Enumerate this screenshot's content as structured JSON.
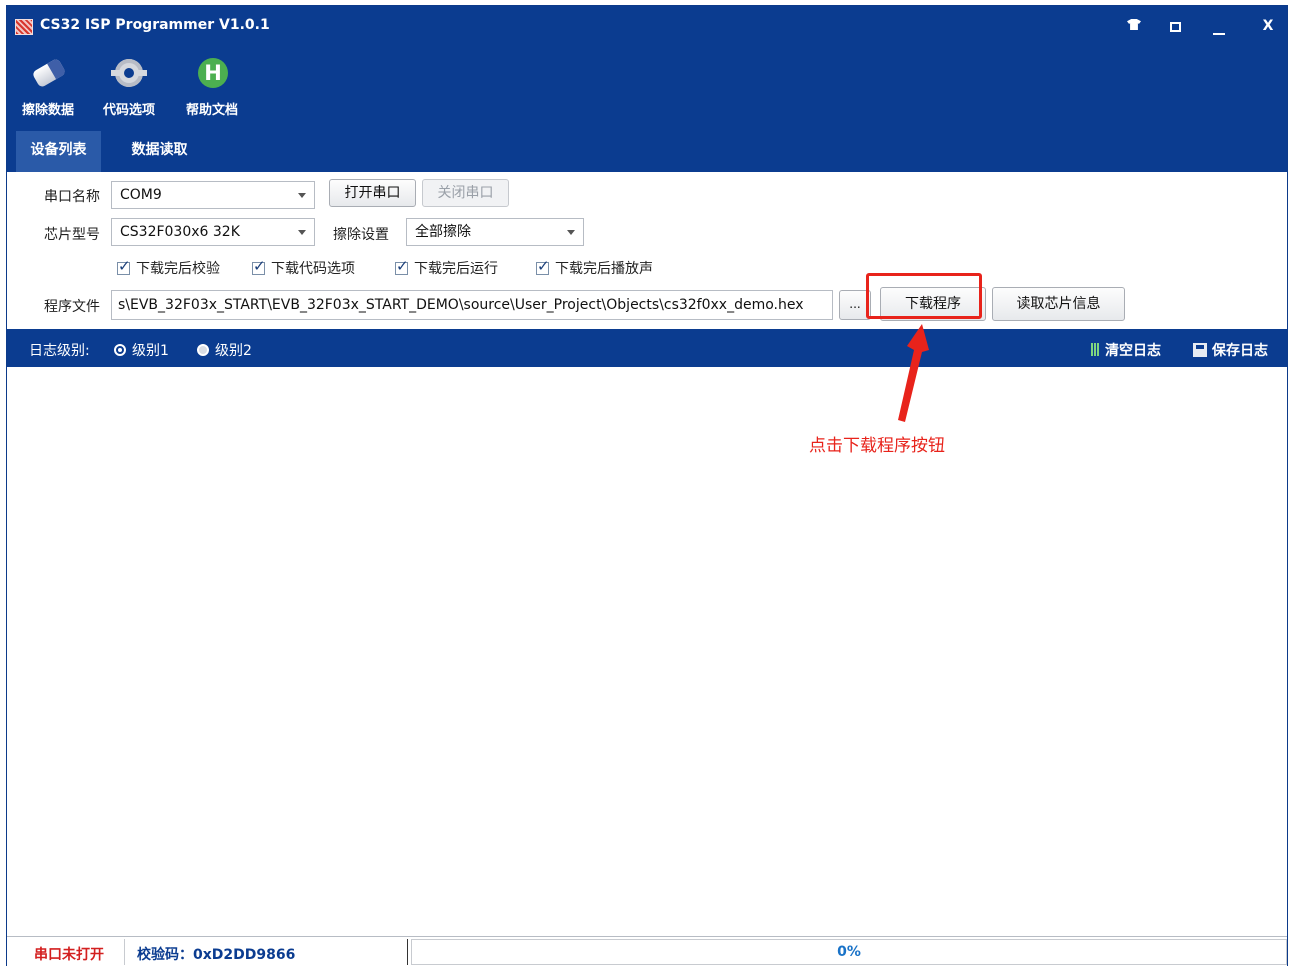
{
  "window": {
    "title": "CS32 ISP Programmer V1.0.1",
    "controls": {
      "minimize": "—",
      "close": "X"
    }
  },
  "toolbar": {
    "erase_label": "擦除数据",
    "code_options_label": "代码选项",
    "help_label": "帮助文档",
    "help_icon_letter": "H"
  },
  "tabs": [
    {
      "label": "设备列表",
      "active": true
    },
    {
      "label": "数据读取",
      "active": false
    }
  ],
  "settings": {
    "port_label": "串口名称",
    "port_value": "COM9",
    "open_port": "打开串口",
    "close_port": "关闭串口",
    "chip_label": "芯片型号",
    "chip_value": "CS32F030x6 32K",
    "erase_label": "擦除设置",
    "erase_value": "全部擦除",
    "checkboxes": [
      {
        "label": "下载完后校验",
        "checked": true
      },
      {
        "label": "下载代码选项",
        "checked": true
      },
      {
        "label": "下载完后运行",
        "checked": true
      },
      {
        "label": "下载完后播放声",
        "checked": true
      }
    ],
    "file_label": "程序文件",
    "file_path": "s\\EVB_32F03x_START\\EVB_32F03x_START_DEMO\\source\\User_Project\\Objects\\cs32f0xx_demo.hex",
    "browse": "...",
    "download": "下载程序",
    "read_chip": "读取芯片信息"
  },
  "log": {
    "level_label": "日志级别:",
    "levels": [
      {
        "label": "级别1",
        "selected": true
      },
      {
        "label": "级别2",
        "selected": false
      }
    ],
    "clear": "清空日志",
    "save": "保存日志"
  },
  "status": {
    "port_state": "串口未打开",
    "checksum": "校验码：0xD2DD9866",
    "progress_value": 0,
    "progress_text": "0%"
  },
  "annotation": {
    "text": "点击下载程序按钮",
    "color": "#e8231b"
  },
  "colors": {
    "primary": "#0b3c90",
    "annotation": "#e8231b",
    "status_error": "#d32020"
  }
}
